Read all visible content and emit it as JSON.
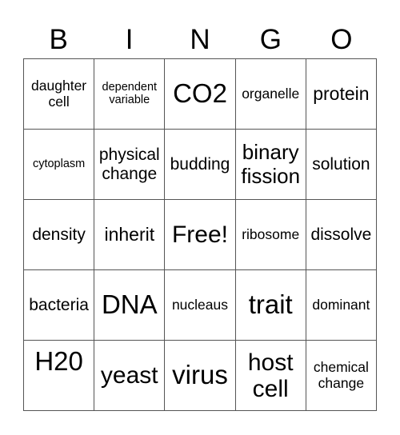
{
  "header": {
    "letters": [
      "B",
      "I",
      "N",
      "G",
      "O"
    ]
  },
  "board": {
    "rows": [
      [
        "daughter\ncell",
        "dependent\nvariable",
        "CO2",
        "organelle",
        "protein"
      ],
      [
        "cytoplasm",
        "physical\nchange",
        "budding",
        "binary\nfission",
        "solution"
      ],
      [
        "density",
        "inherit",
        "Free!",
        "ribosome",
        "dissolve"
      ],
      [
        "bacteria",
        "DNA",
        "nucleaus",
        "trait",
        "dominant"
      ],
      [
        "H20",
        "yeast",
        "virus",
        "host\ncell",
        "chemical\nchange"
      ]
    ],
    "free_space": "Free!",
    "line_color": "#555555",
    "text_color": "#000000",
    "background": "#ffffff"
  }
}
